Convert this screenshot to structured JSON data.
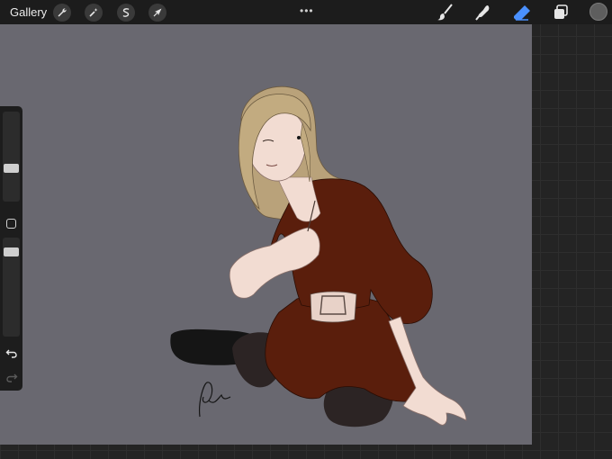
{
  "topbar": {
    "gallery_label": "Gallery",
    "left_tools": [
      {
        "name": "actions",
        "icon": "wrench-icon"
      },
      {
        "name": "adjustments",
        "icon": "magic-wand-icon"
      },
      {
        "name": "selection",
        "icon": "selection-s-icon"
      },
      {
        "name": "transform",
        "icon": "arrow-cursor-icon"
      }
    ],
    "more_label": "•••",
    "right_tools": [
      {
        "name": "brush",
        "icon": "brush-icon"
      },
      {
        "name": "smudge",
        "icon": "smudge-icon"
      },
      {
        "name": "eraser",
        "icon": "eraser-icon",
        "active": true
      },
      {
        "name": "layers",
        "icon": "layers-icon"
      },
      {
        "name": "color",
        "icon": "color-swatch"
      }
    ]
  },
  "canvas": {
    "background": "#696870",
    "artwork": "illustration"
  },
  "sidebar": {
    "brush_size_level": 0.37,
    "opacity_level": 0.17,
    "undo_icon": "undo-arrow-icon",
    "redo_icon": "redo-arrow-icon"
  },
  "colors": {
    "accent": "#4a90ff",
    "current_color": "#5e5e5e",
    "dress": "#5a1e0c",
    "hair": "#b9a27a",
    "skin": "#f2dcd2",
    "leggings": "#2c2424"
  }
}
